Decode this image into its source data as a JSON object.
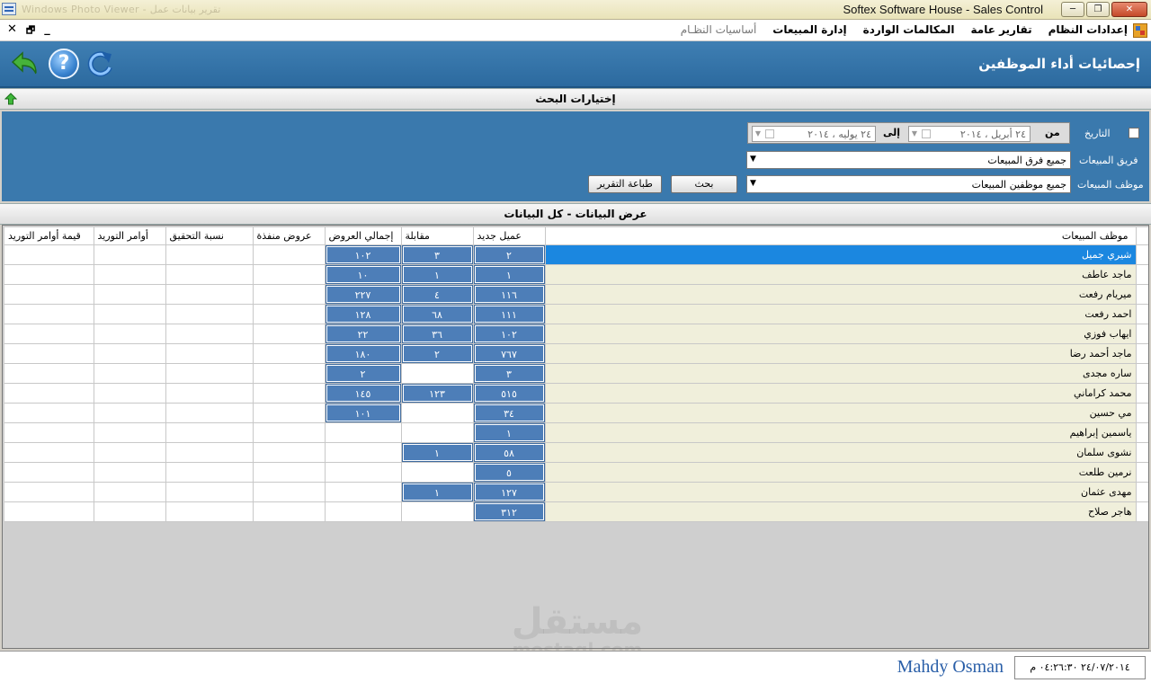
{
  "window": {
    "title": "Softex Software House - Sales Control",
    "ghost_title": "Windows Photo Viewer - تقرير بيانات عمل",
    "minimize": "─",
    "restore": "❐",
    "close": "✕"
  },
  "menubar": {
    "mdi_close": "✕",
    "mdi_restore": "🗗",
    "mdi_minimize": "_",
    "items": [
      {
        "label": "أساسيات النظـام",
        "dim": true
      },
      {
        "label": "إدارة المبيعات",
        "dim": false
      },
      {
        "label": "المكالمات الواردة",
        "dim": false
      },
      {
        "label": "تقارير عامة",
        "dim": false
      },
      {
        "label": "إعدادات النظام",
        "dim": false
      }
    ]
  },
  "header": {
    "page_title": "إحصائيات أداء الموظفين",
    "help_glyph": "?"
  },
  "search_bar": {
    "label": "إختيارات البحث"
  },
  "search": {
    "date_label": "التاريخ",
    "from_label": "من",
    "to_label": "إلى",
    "from_date": "٢٤   أبريل  ، ٢٠١٤",
    "to_date": "٢٤   يوليه  ، ٢٠١٤",
    "team_label": "فريق المبيعات",
    "team_value": "جميع فرق المبيعات",
    "employee_label": "موظف المبيعات",
    "employee_value": "جميع موظفين المبيعات",
    "search_button": "بحث",
    "print_button": "طباعة التقرير"
  },
  "grid_bar": {
    "label": "عرض البيانات - كل البيانات"
  },
  "grid": {
    "headers": {
      "employee": "موظف المبيعات",
      "new_client": "عميل جديد",
      "meeting": "مقابلة",
      "total_offers": "إجمالي العروض",
      "executed_offers": "عروض منفذة",
      "achievement": "نسبة التحقيق",
      "supply_orders": "أوامر التوريد",
      "supply_value": "قيمة أوامر التوريد"
    },
    "rows": [
      {
        "name": "شيري جميل",
        "new_client": "٢",
        "meeting": "٣",
        "total_offers": "١٠٢",
        "selected": true
      },
      {
        "name": "ماجد عاطف",
        "new_client": "١",
        "meeting": "١",
        "total_offers": "١٠"
      },
      {
        "name": "ميريام رفعت",
        "new_client": "١١٦",
        "meeting": "٤",
        "total_offers": "٢٢٧"
      },
      {
        "name": "احمد رفعت",
        "new_client": "١١١",
        "meeting": "٦٨",
        "total_offers": "١٢٨"
      },
      {
        "name": "ايهاب فوزي",
        "new_client": "١٠٢",
        "meeting": "٣٦",
        "total_offers": "٢٢"
      },
      {
        "name": "ماجد أحمد رضا",
        "new_client": "٧٦٧",
        "meeting": "٢",
        "total_offers": "١٨٠"
      },
      {
        "name": "ساره مجدى",
        "new_client": "٣",
        "meeting": "",
        "total_offers": "٢"
      },
      {
        "name": "محمد كراماني",
        "new_client": "٥١٥",
        "meeting": "١٢٣",
        "total_offers": "١٤٥"
      },
      {
        "name": "مي حسين",
        "new_client": "٣٤",
        "meeting": "",
        "total_offers": "١٠١"
      },
      {
        "name": "ياسمين إبراهيم",
        "new_client": "١",
        "meeting": "",
        "total_offers": ""
      },
      {
        "name": "نشوى سلمان",
        "new_client": "٥٨",
        "meeting": "١",
        "total_offers": ""
      },
      {
        "name": "نرمين طلعت",
        "new_client": "٥",
        "meeting": "",
        "total_offers": ""
      },
      {
        "name": "مهدى عثمان",
        "new_client": "١٢٧",
        "meeting": "١",
        "total_offers": ""
      },
      {
        "name": "هاجر صلاح",
        "new_client": "٣١٢",
        "meeting": "",
        "total_offers": ""
      }
    ]
  },
  "status": {
    "user": "Mahdy Osman",
    "datetime": "٢٤/٠٧/٢٠١٤ ٠٤:٢٦:٣٠ م"
  },
  "watermark": {
    "arabic": "مستقل",
    "latin": "mostaql.com"
  },
  "colors": {
    "accent": "#3a79ad",
    "selected_row": "#1b87e0",
    "cell_value": "#4d7eb8",
    "name_column": "#f0efdb"
  }
}
